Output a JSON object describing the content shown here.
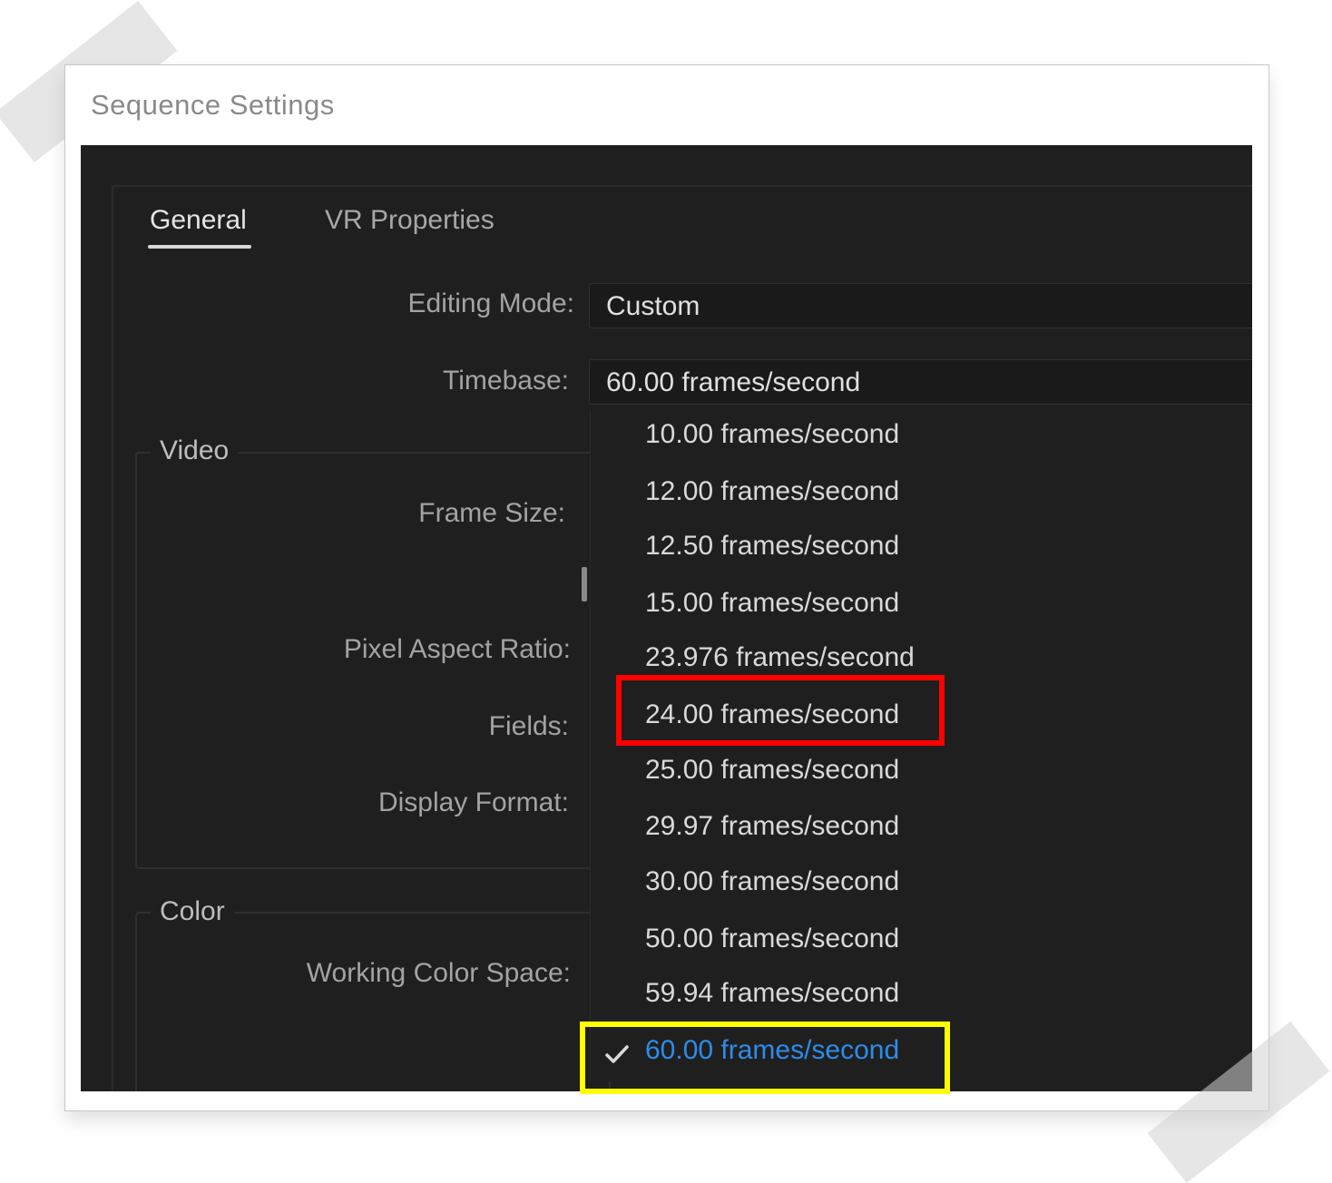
{
  "window": {
    "title": "Sequence Settings"
  },
  "tabs": [
    {
      "label": "General",
      "active": true
    },
    {
      "label": "VR Properties",
      "active": false
    }
  ],
  "fields": {
    "editing_mode": {
      "label": "Editing Mode:",
      "value": "Custom"
    },
    "timebase": {
      "label": "Timebase:",
      "value": "60.00  frames/second"
    }
  },
  "sections": {
    "video": {
      "title": "Video",
      "labels": {
        "frame_size": "Frame Size:",
        "pixel_aspect_ratio": "Pixel Aspect Ratio:",
        "fields": "Fields:",
        "display_format": "Display Format:"
      }
    },
    "color": {
      "title": "Color",
      "labels": {
        "working_color_space": "Working Color Space:"
      }
    }
  },
  "timebase_dropdown": {
    "options": [
      "10.00  frames/second",
      "12.00  frames/second",
      "12.50  frames/second",
      "15.00  frames/second",
      "23.976  frames/second",
      "24.00  frames/second",
      "25.00  frames/second",
      "29.97  frames/second",
      "30.00  frames/second",
      "50.00  frames/second",
      "59.94  frames/second",
      "60.00  frames/second"
    ],
    "selected": "60.00  frames/second",
    "selected_color": "#2d8ceb"
  },
  "annotations": {
    "red_highlight": "24.00  frames/second",
    "yellow_highlight": "60.00  frames/second",
    "red_color": "#ff0000",
    "yellow_color": "#ffff00"
  },
  "icons": {
    "checkmark": "checkmark-icon"
  }
}
